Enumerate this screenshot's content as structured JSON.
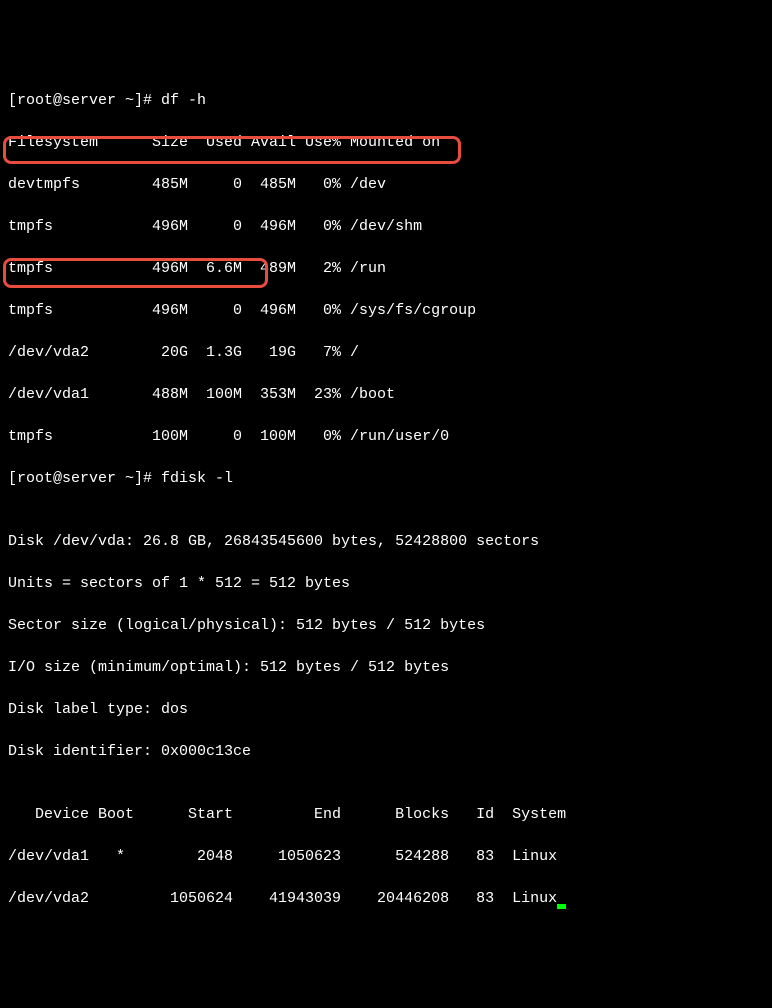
{
  "prompt1": "[root@server ~]# df -h",
  "df_header": "Filesystem      Size  Used Avail Use% Mounted on",
  "df_rows": [
    "devtmpfs        485M     0  485M   0% /dev",
    "tmpfs           496M     0  496M   0% /dev/shm",
    "tmpfs           496M  6.6M  489M   2% /run",
    "tmpfs           496M     0  496M   0% /sys/fs/cgroup",
    "/dev/vda2        20G  1.3G   19G   7% /",
    "/dev/vda1       488M  100M  353M  23% /boot",
    "tmpfs           100M     0  100M   0% /run/user/0"
  ],
  "prompt2": "[root@server ~]# fdisk -l",
  "blank": "",
  "fdisk_lines": [
    "Disk /dev/vda: 26.8 GB, 26843545600 bytes, 52428800 sectors",
    "Units = sectors of 1 * 512 = 512 bytes",
    "Sector size (logical/physical): 512 bytes / 512 bytes",
    "I/O size (minimum/optimal): 512 bytes / 512 bytes",
    "Disk label type: dos",
    "Disk identifier: 0x000c13ce"
  ],
  "part_header": "   Device Boot      Start         End      Blocks   Id  System",
  "part_rows": [
    "/dev/vda1   *        2048     1050623      524288   83  Linux",
    "/dev/vda2         1050624    41943039    20446208   83  Linux"
  ],
  "chart_data": {
    "type": "table",
    "tables": [
      {
        "name": "df -h",
        "columns": [
          "Filesystem",
          "Size",
          "Used",
          "Avail",
          "Use%",
          "Mounted on"
        ],
        "rows": [
          [
            "devtmpfs",
            "485M",
            "0",
            "485M",
            "0%",
            "/dev"
          ],
          [
            "tmpfs",
            "496M",
            "0",
            "496M",
            "0%",
            "/dev/shm"
          ],
          [
            "tmpfs",
            "496M",
            "6.6M",
            "489M",
            "2%",
            "/run"
          ],
          [
            "tmpfs",
            "496M",
            "0",
            "496M",
            "0%",
            "/sys/fs/cgroup"
          ],
          [
            "/dev/vda2",
            "20G",
            "1.3G",
            "19G",
            "7%",
            "/"
          ],
          [
            "/dev/vda1",
            "488M",
            "100M",
            "353M",
            "23%",
            "/boot"
          ],
          [
            "tmpfs",
            "100M",
            "0",
            "100M",
            "0%",
            "/run/user/0"
          ]
        ]
      },
      {
        "name": "fdisk -l partitions",
        "columns": [
          "Device",
          "Boot",
          "Start",
          "End",
          "Blocks",
          "Id",
          "System"
        ],
        "rows": [
          [
            "/dev/vda1",
            "*",
            "2048",
            "1050623",
            "524288",
            "83",
            "Linux"
          ],
          [
            "/dev/vda2",
            "",
            "1050624",
            "41943039",
            "20446208",
            "83",
            "Linux"
          ]
        ]
      }
    ]
  }
}
